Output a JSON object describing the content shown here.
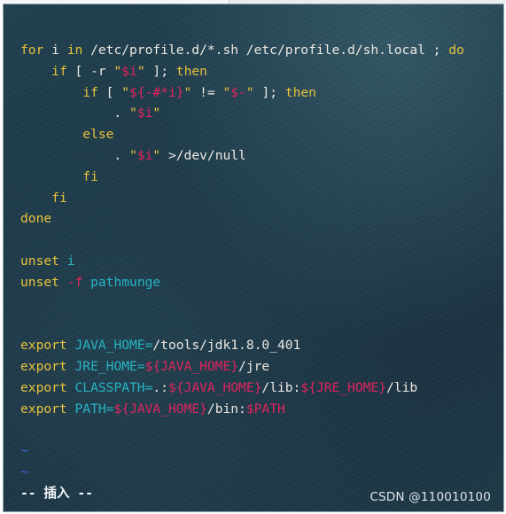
{
  "editor": {
    "lines": [
      [
        {
          "text": "for",
          "cls": "kw"
        },
        {
          "text": " i ",
          "cls": "op"
        },
        {
          "text": "in",
          "cls": "kw"
        },
        {
          "text": " /etc/profile.d/*.sh /etc/profile.d/sh.local ; ",
          "cls": "op"
        },
        {
          "text": "do",
          "cls": "kw"
        }
      ],
      [
        {
          "text": "    ",
          "cls": "op"
        },
        {
          "text": "if",
          "cls": "kw"
        },
        {
          "text": " [ -r ",
          "cls": "op"
        },
        {
          "text": "\"",
          "cls": "str"
        },
        {
          "text": "$i",
          "cls": "var"
        },
        {
          "text": "\"",
          "cls": "str"
        },
        {
          "text": " ]; ",
          "cls": "op"
        },
        {
          "text": "then",
          "cls": "kw"
        }
      ],
      [
        {
          "text": "        ",
          "cls": "op"
        },
        {
          "text": "if",
          "cls": "kw"
        },
        {
          "text": " [ ",
          "cls": "op"
        },
        {
          "text": "\"",
          "cls": "str"
        },
        {
          "text": "${-#*i}",
          "cls": "var"
        },
        {
          "text": "\"",
          "cls": "str"
        },
        {
          "text": " != ",
          "cls": "op"
        },
        {
          "text": "\"",
          "cls": "str"
        },
        {
          "text": "$-",
          "cls": "var"
        },
        {
          "text": "\"",
          "cls": "str"
        },
        {
          "text": " ]; ",
          "cls": "op"
        },
        {
          "text": "then",
          "cls": "kw"
        }
      ],
      [
        {
          "text": "            . ",
          "cls": "op"
        },
        {
          "text": "\"",
          "cls": "str"
        },
        {
          "text": "$i",
          "cls": "var"
        },
        {
          "text": "\"",
          "cls": "str"
        }
      ],
      [
        {
          "text": "        ",
          "cls": "op"
        },
        {
          "text": "else",
          "cls": "kw"
        }
      ],
      [
        {
          "text": "            . ",
          "cls": "op"
        },
        {
          "text": "\"",
          "cls": "str"
        },
        {
          "text": "$i",
          "cls": "var"
        },
        {
          "text": "\"",
          "cls": "str"
        },
        {
          "text": " >/dev/null",
          "cls": "op"
        }
      ],
      [
        {
          "text": "        ",
          "cls": "op"
        },
        {
          "text": "fi",
          "cls": "kw"
        }
      ],
      [
        {
          "text": "    ",
          "cls": "op"
        },
        {
          "text": "fi",
          "cls": "kw"
        }
      ],
      [
        {
          "text": "done",
          "cls": "kw"
        }
      ],
      [],
      [
        {
          "text": "unset",
          "cls": "kw"
        },
        {
          "text": " ",
          "cls": "op"
        },
        {
          "text": "i",
          "cls": "id"
        }
      ],
      [
        {
          "text": "unset",
          "cls": "kw"
        },
        {
          "text": " ",
          "cls": "op"
        },
        {
          "text": "-f",
          "cls": "flag"
        },
        {
          "text": " ",
          "cls": "op"
        },
        {
          "text": "pathmunge",
          "cls": "id"
        }
      ],
      [],
      [],
      [
        {
          "text": "export",
          "cls": "kw"
        },
        {
          "text": " ",
          "cls": "op"
        },
        {
          "text": "JAVA_HOME",
          "cls": "id"
        },
        {
          "text": "=",
          "cls": "id"
        },
        {
          "text": "/tools/jdk1.8.0_401",
          "cls": "op"
        }
      ],
      [
        {
          "text": "export",
          "cls": "kw"
        },
        {
          "text": " ",
          "cls": "op"
        },
        {
          "text": "JRE_HOME",
          "cls": "id"
        },
        {
          "text": "=",
          "cls": "id"
        },
        {
          "text": "${JAVA_HOME}",
          "cls": "var"
        },
        {
          "text": "/jre",
          "cls": "op"
        }
      ],
      [
        {
          "text": "export",
          "cls": "kw"
        },
        {
          "text": " ",
          "cls": "op"
        },
        {
          "text": "CLASSPATH",
          "cls": "id"
        },
        {
          "text": "=",
          "cls": "id"
        },
        {
          "text": ".:",
          "cls": "op"
        },
        {
          "text": "${JAVA_HOME}",
          "cls": "var"
        },
        {
          "text": "/lib:",
          "cls": "op"
        },
        {
          "text": "${JRE_HOME}",
          "cls": "var"
        },
        {
          "text": "/lib",
          "cls": "op"
        }
      ],
      [
        {
          "text": "export",
          "cls": "kw"
        },
        {
          "text": " ",
          "cls": "op"
        },
        {
          "text": "PATH",
          "cls": "id"
        },
        {
          "text": "=",
          "cls": "id"
        },
        {
          "text": "${JAVA_HOME}",
          "cls": "var"
        },
        {
          "text": "/bin:",
          "cls": "op"
        },
        {
          "text": "$PATH",
          "cls": "var"
        }
      ],
      [],
      [
        {
          "text": "~",
          "cls": "tilde"
        }
      ],
      [
        {
          "text": "~",
          "cls": "tilde"
        }
      ]
    ],
    "mode_line": "-- 插入 --"
  },
  "watermark": "CSDN @110010100",
  "colors": {
    "keyword": "#e8c23a",
    "variable": "#e0245e",
    "identifier": "#27b4c4",
    "text": "#ece9e2",
    "tilde": "#3a74d8",
    "background": "#1b3645"
  }
}
